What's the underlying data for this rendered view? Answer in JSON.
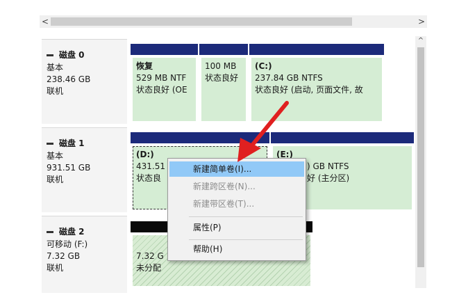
{
  "scrollbar": {
    "left_arrow": "<",
    "right_arrow": ">",
    "up_arrow": "^"
  },
  "disks": [
    {
      "name": "磁盘 0",
      "type": "基本",
      "size": "238.46 GB",
      "status": "联机"
    },
    {
      "name": "磁盘 1",
      "type": "基本",
      "size": "931.51 GB",
      "status": "联机"
    },
    {
      "name": "磁盘 2",
      "type": "可移动 (F:)",
      "size": "7.32 GB",
      "status": "联机"
    }
  ],
  "partitions": {
    "d0p1": {
      "label": "恢复",
      "size": "529 MB NTF",
      "status": "状态良好 (OE"
    },
    "d0p2": {
      "label": "",
      "size": "100 MB",
      "status": "状态良好"
    },
    "d0p3": {
      "label": "(C:)",
      "size": "237.84 GB NTFS",
      "status": "状态良好 (启动, 页面文件, 故"
    },
    "d1p1": {
      "label": "(D:)",
      "size": "431.51",
      "status": "状态良"
    },
    "d1p2": {
      "label": "(E:)",
      "size": ") GB NTFS",
      "status": "好 (主分区)"
    },
    "d2p1": {
      "label": "",
      "size": "7.32 G",
      "status": "未分配"
    }
  },
  "context_menu": {
    "items": [
      {
        "label": "新建简单卷(I)...",
        "enabled": true,
        "highlighted": true
      },
      {
        "label": "新建跨区卷(N)...",
        "enabled": false
      },
      {
        "label": "新建带区卷(T)...",
        "enabled": false
      },
      {
        "label": "属性(P)",
        "enabled": true
      },
      {
        "label": "帮助(H)",
        "enabled": true
      }
    ]
  },
  "colors": {
    "primary_bar": "#1c2a7a",
    "unallocated_bar": "#0a0a0a",
    "partition_fill": "#d5edd4",
    "menu_highlight": "#91c9f7",
    "arrow_red": "#e02020"
  }
}
